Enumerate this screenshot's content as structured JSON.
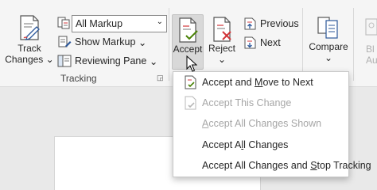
{
  "ribbon": {
    "track_changes": {
      "line1": "Track",
      "line2": "Changes",
      "arrow": "⌄"
    },
    "markup_combo": {
      "value": "All Markup",
      "arrow": "⌄"
    },
    "show_markup": {
      "label": "Show Markup",
      "arrow": "⌄"
    },
    "reviewing_pane": {
      "label": "Reviewing Pane",
      "arrow": "⌄"
    },
    "tracking_group": "Tracking",
    "accept": {
      "label": "Accept"
    },
    "reject": {
      "label": "Reject",
      "arrow": "⌄"
    },
    "previous": {
      "label": "Previous"
    },
    "next": {
      "label": "Next"
    },
    "compare": {
      "label": "Compare",
      "arrow": "⌄"
    },
    "faded": {
      "line1": "Bl",
      "line2": "Aut"
    }
  },
  "accept_menu": {
    "items": [
      {
        "pre": "Accept and ",
        "u": "M",
        "post": "ove to Next",
        "enabled": true
      },
      {
        "pre": "Accept This Change",
        "u": "",
        "post": "",
        "enabled": false
      },
      {
        "pre": "",
        "u": "A",
        "post": "ccept All Changes Shown",
        "enabled": false
      },
      {
        "pre": "Accept A",
        "u": "l",
        "post": "l Changes",
        "enabled": true
      },
      {
        "pre": "Accept All Changes and ",
        "u": "S",
        "post": "top Tracking",
        "enabled": true
      }
    ]
  },
  "colors": {
    "accent_red": "#d13438",
    "accent_green": "#498205",
    "doc_icon_blue": "#2b579a"
  }
}
